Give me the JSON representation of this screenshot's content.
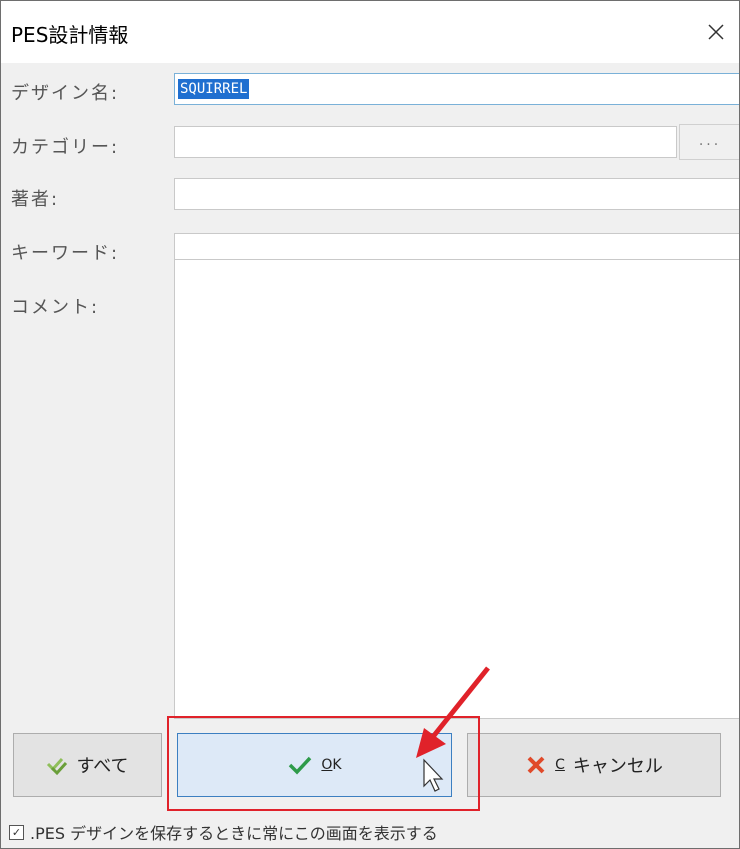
{
  "window": {
    "title": "PES設計情報"
  },
  "fields": {
    "design_name": {
      "label": "デザイン名:",
      "value": "SQUIRREL"
    },
    "category": {
      "label": "カテゴリー:",
      "value": "",
      "browse_label": "..."
    },
    "author": {
      "label": "著者:",
      "value": ""
    },
    "keyword": {
      "label": "キーワード:",
      "value": ""
    },
    "comment": {
      "label": "コメント:",
      "value": ""
    }
  },
  "buttons": {
    "all": {
      "label": "すべて"
    },
    "ok": {
      "mnemonic": "O",
      "label_rest": "K"
    },
    "cancel": {
      "mnemonic": "C",
      "label": "キャンセル"
    }
  },
  "footer": {
    "checked": true,
    "label": ".PES デザインを保存するときに常にこの画面を表示する"
  },
  "colors": {
    "selection": "#1f6fd0",
    "annotation": "#e0222a",
    "ok_check": "#2e9b4a",
    "cancel_x": "#e04a2a"
  }
}
